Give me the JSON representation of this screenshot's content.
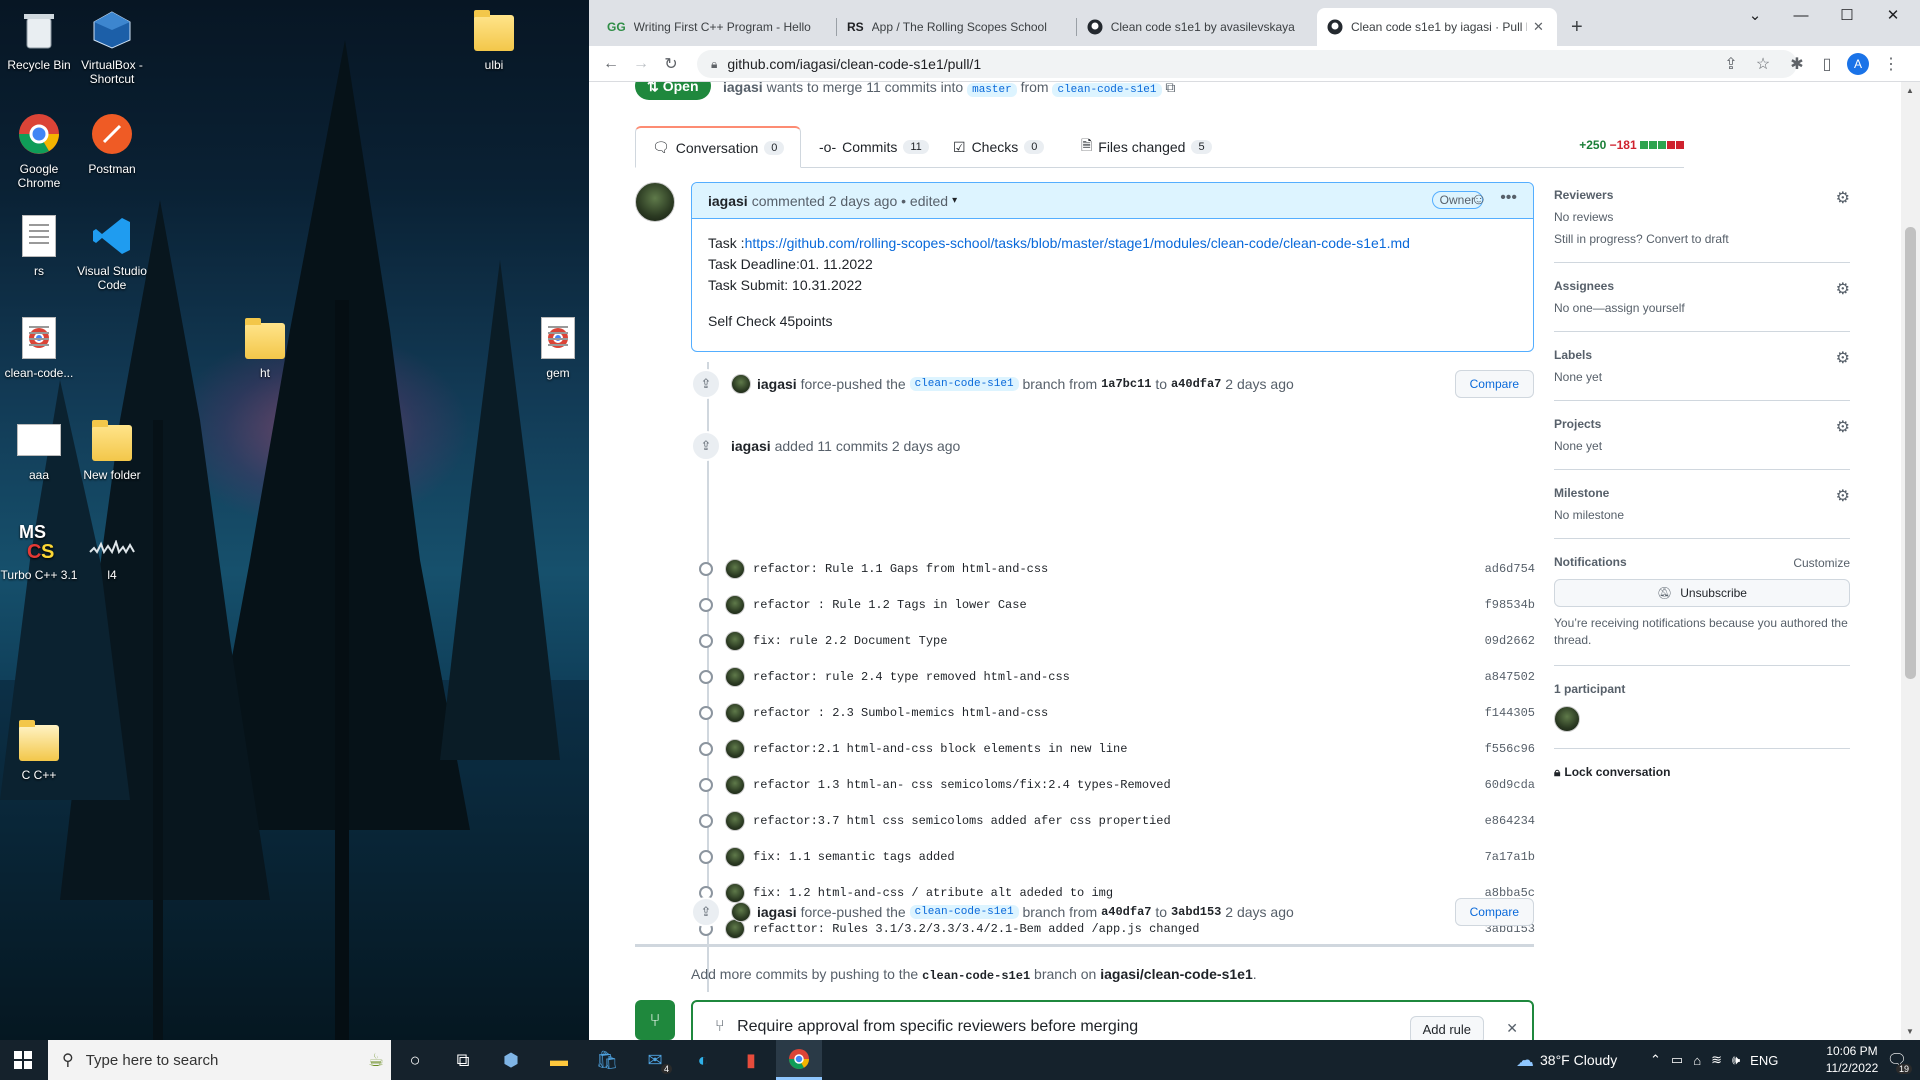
{
  "desktop": {
    "icons": [
      {
        "label": "Recycle Bin",
        "icon": "recycle-bin-icon"
      },
      {
        "label": "VirtualBox - Shortcut",
        "icon": "virtualbox-icon"
      },
      {
        "label": "ulbi",
        "icon": "folder-icon"
      },
      {
        "label": "Google Chrome",
        "icon": "chrome-icon"
      },
      {
        "label": "Postman",
        "icon": "postman-icon"
      },
      {
        "label": "rs",
        "icon": "document-icon"
      },
      {
        "label": "Visual Studio Code",
        "icon": "vscode-icon"
      },
      {
        "label": "clean-code...",
        "icon": "chrome-file-icon"
      },
      {
        "label": "ht",
        "icon": "folder-icon"
      },
      {
        "label": "gem",
        "icon": "chrome-file-icon"
      },
      {
        "label": "aaa",
        "icon": "text-file-icon"
      },
      {
        "label": "New folder",
        "icon": "folder-icon"
      },
      {
        "label": "Turbo C++ 3.1",
        "icon": "turbo-c-icon"
      },
      {
        "label": "l4",
        "icon": "audio-file-icon"
      },
      {
        "label": "C C++",
        "icon": "document-icon"
      }
    ]
  },
  "browser": {
    "tabs": [
      {
        "title": "Writing First C++ Program - Hello",
        "icon": "gfg-icon"
      },
      {
        "title": "App / The Rolling Scopes School",
        "icon": "rs-icon"
      },
      {
        "title": "Clean code s1e1 by avasilevskaya",
        "icon": "github-icon"
      },
      {
        "title": "Clean code s1e1 by iagasi · Pull R",
        "icon": "github-icon"
      }
    ],
    "url": "github.com/iagasi/clean-code-s1e1/pull/1",
    "profile_initial": "A"
  },
  "pr": {
    "status": "Open",
    "author": "iagasi",
    "merge_text": "wants to merge 11 commits into",
    "base_branch": "master",
    "from_text": "from",
    "head_branch": "clean-code-s1e1",
    "tabs": [
      {
        "label": "Conversation",
        "count": "0"
      },
      {
        "label": "Commits",
        "count": "11"
      },
      {
        "label": "Checks",
        "count": "0"
      },
      {
        "label": "Files changed",
        "count": "5"
      }
    ],
    "additions": "+250",
    "deletions": "−181",
    "comment": {
      "author": "iagasi",
      "meta": "commented 2 days ago • edited",
      "role": "Owner",
      "task_label": "Task :",
      "task_link": "https://github.com/rolling-scopes-school/tasks/blob/master/stage1/modules/clean-code/clean-code-s1e1.md",
      "deadline": "Task Deadline:01. 11.2022",
      "submit": "Task Submit: 10.31.2022",
      "selfcheck": "Self Check 45points"
    },
    "push1": {
      "author": "iagasi",
      "text": "force-pushed the",
      "branch": "clean-code-s1e1",
      "from_text": "branch from",
      "from_sha": "1a7bc11",
      "to_text": "to",
      "to_sha": "a40dfa7",
      "time": "2 days ago",
      "button": "Compare"
    },
    "added": {
      "author": "iagasi",
      "text": "added 11 commits 2 days ago"
    },
    "commits": [
      {
        "msg": "refactor: Rule 1.1 Gaps from html-and-css",
        "sha": "ad6d754"
      },
      {
        "msg": "refactor : Rule 1.2 Tags in lower Case",
        "sha": "f98534b"
      },
      {
        "msg": "fix: rule 2.2 Document Type",
        "sha": "09d2662"
      },
      {
        "msg": "refactor: rule 2.4 type removed html-and-css",
        "sha": "a847502"
      },
      {
        "msg": "refactor : 2.3 Sumbol-memics html-and-css",
        "sha": "f144305"
      },
      {
        "msg": "refactor:2.1 html-and-css block elements in new line",
        "sha": "f556c96"
      },
      {
        "msg": "refactor 1.3 html-an- css semicoloms/fix:2.4 types-Removed",
        "sha": "60d9cda"
      },
      {
        "msg": "refactor:3.7 html css semicoloms added afer css propertied",
        "sha": "e864234"
      },
      {
        "msg": "fix: 1.1 semantic tags added",
        "sha": "7a17a1b"
      },
      {
        "msg": "fix: 1.2 html-and-css / atribute alt adeded to img",
        "sha": "a8bba5c"
      },
      {
        "msg": "refacttor: Rules 3.1/3.2/3.3/3.4/2.1-Bem added /app.js changed",
        "sha": "3abd153"
      }
    ],
    "push2": {
      "author": "iagasi",
      "text": "force-pushed the",
      "branch": "clean-code-s1e1",
      "from_text": "branch from",
      "from_sha": "a40dfa7",
      "to_text": "to",
      "to_sha": "3abd153",
      "time": "2 days ago",
      "button": "Compare"
    },
    "more_commits": {
      "prefix": "Add more commits by pushing to the",
      "branch": "clean-code-s1e1",
      "mid": "branch on",
      "repo": "iagasi/clean-code-s1e1",
      "end": "."
    },
    "rule_box": {
      "title": "Require approval from specific reviewers before merging",
      "button": "Add rule"
    }
  },
  "sidebar": {
    "reviewers": {
      "title": "Reviewers",
      "value": "No reviews",
      "extra_prefix": "Still in progress?",
      "extra_link": "Convert to draft"
    },
    "assignees": {
      "title": "Assignees",
      "value": "No one—assign yourself"
    },
    "labels": {
      "title": "Labels",
      "value": "None yet"
    },
    "projects": {
      "title": "Projects",
      "value": "None yet"
    },
    "milestone": {
      "title": "Milestone",
      "value": "No milestone"
    },
    "notifications": {
      "title": "Notifications",
      "customize": "Customize",
      "button": "Unsubscribe",
      "note": "You’re receiving notifications because you authored the thread."
    },
    "participants": {
      "title": "1 participant"
    },
    "lock": "Lock conversation"
  },
  "taskbar": {
    "search_placeholder": "Type here to search",
    "weather": "38°F Cloudy",
    "lang": "ENG",
    "time": "10:06 PM",
    "date": "11/2/2022",
    "mail_badge": "4",
    "notif_badge": "19"
  },
  "colors": {
    "accent": "#0969da",
    "open_green": "#1f883d",
    "add_green": "#1a7f37",
    "del_red": "#cf222e",
    "taskbar": "#15222c"
  }
}
